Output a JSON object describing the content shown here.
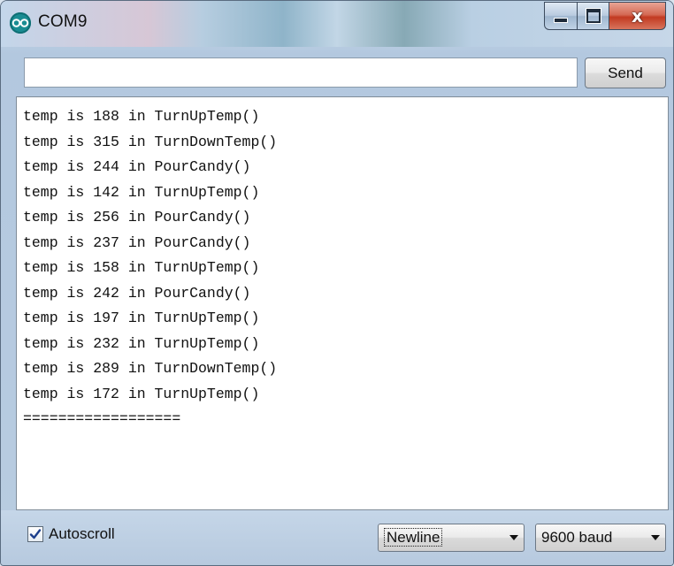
{
  "window": {
    "title": "COM9",
    "close_glyph": "x"
  },
  "send_bar": {
    "input_value": "",
    "send_label": "Send"
  },
  "output": {
    "lines": [
      "temp is 188 in TurnUpTemp()",
      "temp is 315 in TurnDownTemp()",
      "temp is 244 in PourCandy()",
      "temp is 142 in TurnUpTemp()",
      "temp is 256 in PourCandy()",
      "temp is 237 in PourCandy()",
      "temp is 158 in TurnUpTemp()",
      "temp is 242 in PourCandy()",
      "temp is 197 in TurnUpTemp()",
      "temp is 232 in TurnUpTemp()",
      "temp is 289 in TurnDownTemp()",
      "temp is 172 in TurnUpTemp()",
      "=================="
    ]
  },
  "footer": {
    "autoscroll_label": "Autoscroll",
    "autoscroll_checked": true,
    "line_ending": "Newline",
    "baud_rate": "9600 baud"
  },
  "icons": {
    "app": "arduino-logo-icon",
    "minimize": "minimize-icon",
    "maximize": "maximize-icon",
    "close": "close-icon",
    "check": "checkmark-icon",
    "dropdown": "chevron-down-icon"
  },
  "colors": {
    "close_button": "#c23a21",
    "app_icon": "#1a8c92"
  }
}
